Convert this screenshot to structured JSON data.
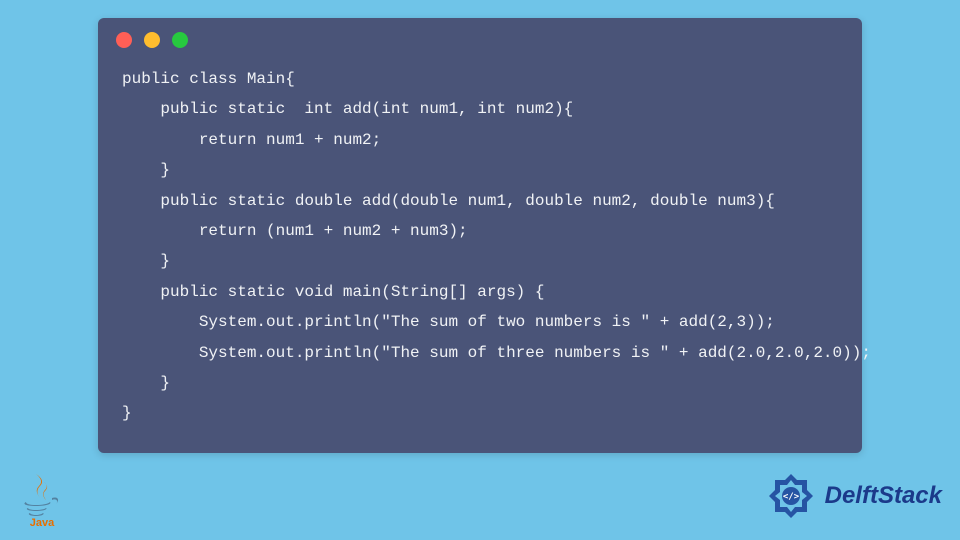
{
  "code": {
    "lines": [
      "public class Main{",
      "    public static  int add(int num1, int num2){",
      "        return num1 + num2;",
      "    }",
      "    public static double add(double num1, double num2, double num3){",
      "        return (num1 + num2 + num3);",
      "    }",
      "    public static void main(String[] args) {",
      "        System.out.println(\"The sum of two numbers is \" + add(2,3));",
      "        System.out.println(\"The sum of three numbers is \" + add(2.0,2.0,2.0));",
      "    }",
      "}"
    ]
  },
  "branding": {
    "java_label": "Java",
    "delft_label": "DelftStack"
  },
  "window": {
    "dots": [
      "#ff5f56",
      "#ffbd2e",
      "#27c93f"
    ]
  }
}
